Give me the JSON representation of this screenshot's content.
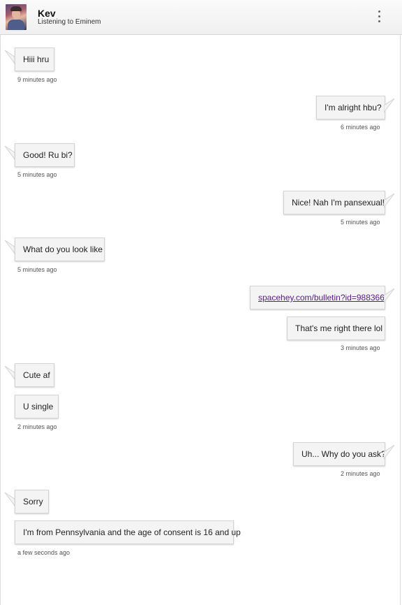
{
  "header": {
    "name": "Kev",
    "status": "Listening to Eminem"
  },
  "messages": {
    "m1": "Hiii hru",
    "m2": "I'm alright hbu?",
    "m3": "Good! Ru bi?",
    "m4": "Nice! Nah I'm pansexual!",
    "m5": "What do you look like",
    "m6": "spacehey.com/bulletin?id=988366",
    "m7": "That's me right there lol",
    "m8": "Cute af",
    "m9": "U single",
    "m10": "Uh... Why do you ask?",
    "m11": "Sorry",
    "m12": "I'm from Pennsylvania and the age of consent is 16 and up"
  },
  "times": {
    "t1": "9 minutes ago",
    "t2": "6 minutes ago",
    "t3": "5 minutes ago",
    "t4": "5 minutes ago",
    "t5": "5 minutes ago",
    "t6": "3 minutes ago",
    "t7": "2 minutes ago",
    "t8": "2 minutes ago",
    "t9": "a few seconds ago"
  },
  "icons": {
    "menu": "vertical-ellipsis-icon"
  }
}
